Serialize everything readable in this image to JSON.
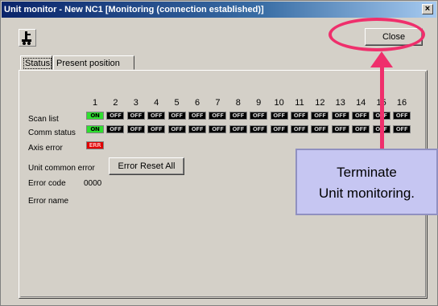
{
  "window": {
    "title": "Unit monitor - New NC1 [Monitoring (connection established)]",
    "close_glyph": "×"
  },
  "toolbar": {
    "close_label": "Close",
    "app_icon": "unit-monitor-icon"
  },
  "tabs": [
    {
      "label": "Status",
      "selected": true
    },
    {
      "label": "Present position",
      "selected": false
    }
  ],
  "status": {
    "axis_numbers": [
      "1",
      "2",
      "3",
      "4",
      "5",
      "6",
      "7",
      "8",
      "9",
      "10",
      "11",
      "12",
      "13",
      "14",
      "15",
      "16"
    ],
    "rows": [
      {
        "label": "Scan list",
        "leds": [
          "ON",
          "OFF",
          "OFF",
          "OFF",
          "OFF",
          "OFF",
          "OFF",
          "OFF",
          "OFF",
          "OFF",
          "OFF",
          "OFF",
          "OFF",
          "OFF",
          "OFF",
          "OFF"
        ]
      },
      {
        "label": "Comm status",
        "leds": [
          "ON",
          "OFF",
          "OFF",
          "OFF",
          "OFF",
          "OFF",
          "OFF",
          "OFF",
          "OFF",
          "OFF",
          "OFF",
          "OFF",
          "OFF",
          "OFF",
          "OFF",
          "OFF"
        ]
      },
      {
        "label": "Axis error",
        "leds": [
          "ERR"
        ]
      }
    ],
    "unit_common_error_label": "Unit common error",
    "error_reset_label": "Error Reset All",
    "error_code_label": "Error code",
    "error_code_value": "0000",
    "error_name_label": "Error name"
  },
  "annotation": {
    "callout_line1": "Terminate",
    "callout_line2": "Unit monitoring.",
    "color": "#ef2f6c",
    "callout_bg": "#c6c6f2"
  }
}
